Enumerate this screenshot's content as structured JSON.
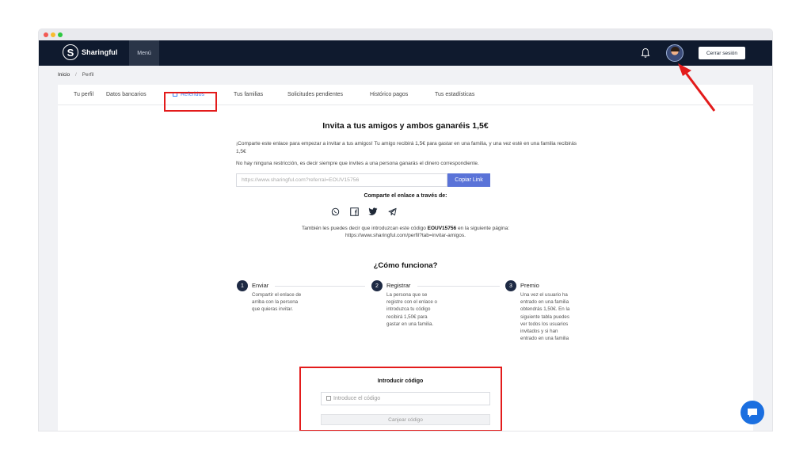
{
  "nav": {
    "logo_mark": "S",
    "logo_text": "Sharingful",
    "menu_label": "Menú",
    "logout_label": "Cerrar sesión"
  },
  "breadcrumb": {
    "home": "Inicio",
    "separator": "/",
    "current": "Perfil"
  },
  "tabs": [
    {
      "label": "Tu perfil"
    },
    {
      "label": "Datos bancarios"
    },
    {
      "label": "Referidos"
    },
    {
      "label": "Tus familias"
    },
    {
      "label": "Solicitudes pendientes"
    },
    {
      "label": "Histórico pagos"
    },
    {
      "label": "Tus estadísticas"
    }
  ],
  "referral": {
    "title": "Invita a tus amigos y ambos ganaréis 1,5€",
    "intro": "¡Comparte este enlace para empezar a invitar a tus amigos! Tu amigo recibirá 1,5€ para gastar en una familia, y una vez esté en una familia recibirás 1,5€",
    "note": "No hay ninguna restricción, es decir siempre que invites a una persona ganarás el dinero correspondiente.",
    "link": "https://www.sharingful.com?referral=EOUV15756",
    "copy_label": "Copiar Link",
    "share_title": "Comparte el enlace a través de:",
    "info_pre": "También les puedes decir que introduzcan este código",
    "code": "EOUV15756",
    "info_post": "en la siguiente página:",
    "info_url": "https://www.sharingful.com/perfil?tab=invitar-amigos."
  },
  "how": {
    "title": "¿Cómo funciona?",
    "steps": [
      {
        "num": "1",
        "title": "Enviar",
        "desc": "Compartir el enlace de arriba con la persona que quieras invitar."
      },
      {
        "num": "2",
        "title": "Registrar",
        "desc": "La persona que se registre con el enlace o introduzca tu código recibirá 1,50€ para gastar en una familia."
      },
      {
        "num": "3",
        "title": "Premio",
        "desc": "Una vez el usuario ha entrado en una familia obtendrás 1,50€. En la siguiente tabla puedes ver todos los usuarios invitados y si han entrado en una familia"
      }
    ]
  },
  "code_entry": {
    "title": "Introducir código",
    "placeholder": "Introduce el código",
    "button": "Canjear código"
  },
  "icons": {
    "share": [
      "whatsapp-icon",
      "facebook-icon",
      "twitter-icon",
      "telegram-icon"
    ]
  },
  "colors": {
    "navbar": "#0f1a2e",
    "accent": "#3b82f6",
    "copy_button": "#5a73d8",
    "annotation": "#e31b1b",
    "chat": "#1b6fe0"
  }
}
